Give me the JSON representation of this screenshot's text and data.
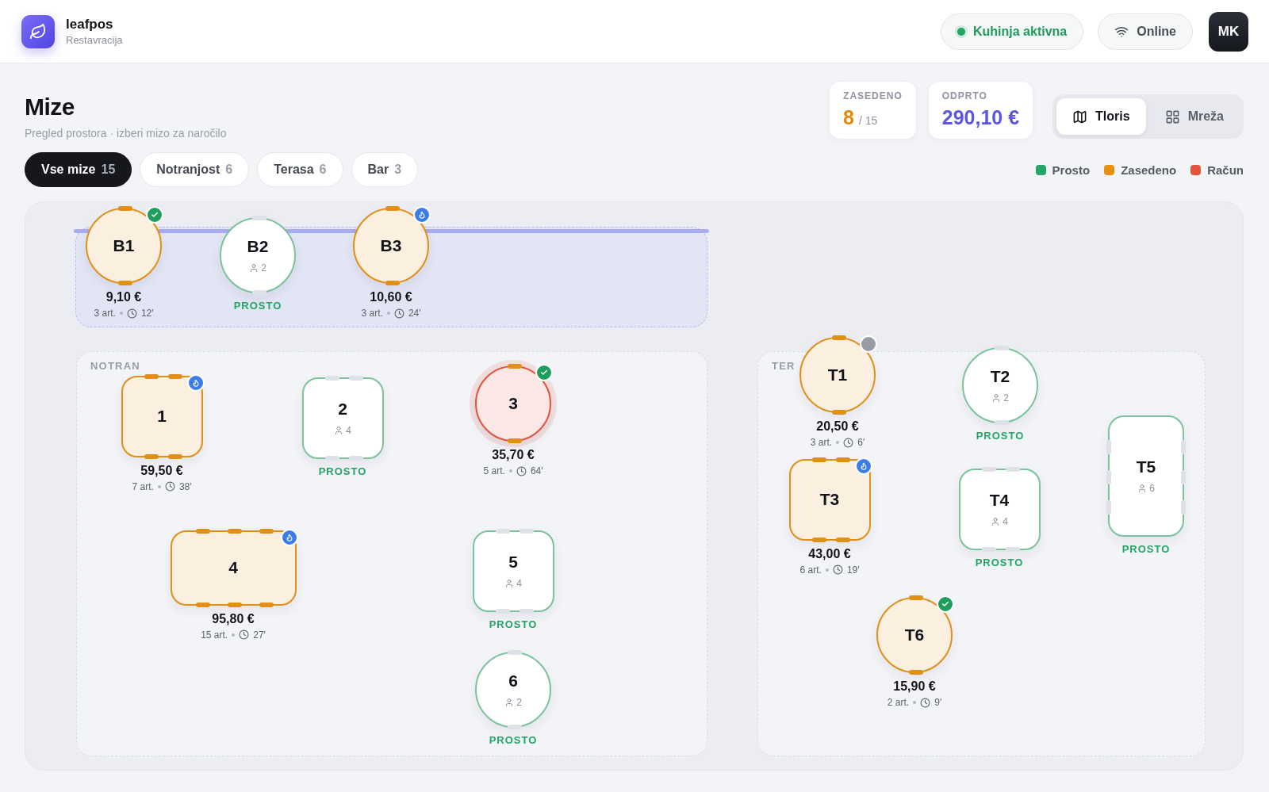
{
  "app": {
    "name": "leafpos",
    "subtitle": "Restavracija"
  },
  "header": {
    "kitchen": {
      "label": "Kuhinja aktivna",
      "on": true
    },
    "connection": {
      "label": "Online"
    },
    "user": {
      "initials": "MK"
    }
  },
  "page": {
    "title": "Mize",
    "subtitle": "Pregled prostora · izberi mizo za naročilo"
  },
  "stats": [
    {
      "label": "ZASEDENO",
      "value": "8",
      "suffix": "/ 15",
      "kind": "count"
    },
    {
      "label": "ODPRTO",
      "value": "290,10 €",
      "kind": "money"
    }
  ],
  "views": [
    {
      "label": "Tloris",
      "selected": true
    },
    {
      "label": "Mreža",
      "selected": false
    }
  ],
  "filters": [
    {
      "label": "Vse mize",
      "count": "15",
      "selected": true
    },
    {
      "label": "Notranjost",
      "count": "6",
      "selected": false
    },
    {
      "label": "Terasa",
      "count": "6",
      "selected": false
    },
    {
      "label": "Bar",
      "count": "3",
      "selected": false
    }
  ],
  "legend": [
    {
      "label": "Prosto",
      "color": "#22a565"
    },
    {
      "label": "Zasedeno",
      "color": "#e8900c"
    },
    {
      "label": "Račun",
      "color": "#e5533d"
    }
  ],
  "zones": [
    {
      "highlighted": true
    },
    {
      "label": "NOTRAN",
      "highlighted": false
    },
    {
      "label": "TER",
      "highlighted": false
    }
  ],
  "tables": [
    {
      "name": "B1",
      "kind": "round",
      "color": "#e08f17",
      "occupied": true,
      "bill": false,
      "badge": {
        "kind": "ready"
      },
      "price": "9,10 €",
      "items": "3 art.",
      "time": "12′"
    },
    {
      "name": "B2",
      "kind": "round",
      "color": "#7cc39c",
      "occupied": false,
      "bill": false,
      "seats": "2",
      "label": "PROSTO"
    },
    {
      "name": "B3",
      "kind": "round",
      "color": "#e08f17",
      "occupied": true,
      "bill": false,
      "badge": {
        "kind": "cooking"
      },
      "price": "10,60 €",
      "items": "3 art.",
      "time": "24′"
    },
    {
      "name": "1",
      "kind": "square",
      "color": "#e08f17",
      "occupied": true,
      "bill": false,
      "badge": {
        "kind": "cooking"
      },
      "price": "59,50 €",
      "items": "7 art.",
      "time": "38′"
    },
    {
      "name": "2",
      "kind": "square",
      "color": "#7cc39c",
      "occupied": false,
      "bill": false,
      "seats": "4",
      "label": "PROSTO"
    },
    {
      "name": "3",
      "kind": "round",
      "color": "#e0533f",
      "occupied": true,
      "bill": true,
      "badge": {
        "kind": "ready"
      },
      "price": "35,70 €",
      "items": "5 art.",
      "time": "64′"
    },
    {
      "name": "4",
      "kind": "wide",
      "color": "#e08f17",
      "occupied": true,
      "bill": false,
      "badge": {
        "kind": "cooking"
      },
      "price": "95,80 €",
      "items": "15 art.",
      "time": "27′"
    },
    {
      "name": "5",
      "kind": "square",
      "color": "#7cc39c",
      "occupied": false,
      "bill": false,
      "seats": "4",
      "label": "PROSTO"
    },
    {
      "name": "6",
      "kind": "round",
      "color": "#7cc39c",
      "occupied": false,
      "bill": false,
      "seats": "2",
      "label": "PROSTO"
    },
    {
      "name": "T1",
      "kind": "round",
      "color": "#e08f17",
      "occupied": true,
      "bill": false,
      "badge": {
        "kind": "waiting"
      },
      "price": "20,50 €",
      "items": "3 art.",
      "time": "6′"
    },
    {
      "name": "T2",
      "kind": "round",
      "color": "#7cc39c",
      "occupied": false,
      "bill": false,
      "seats": "2",
      "label": "PROSTO"
    },
    {
      "name": "T3",
      "kind": "square",
      "color": "#e08f17",
      "occupied": true,
      "bill": false,
      "badge": {
        "kind": "cooking"
      },
      "price": "43,00 €",
      "items": "6 art.",
      "time": "19′"
    },
    {
      "name": "T4",
      "kind": "square",
      "color": "#7cc39c",
      "occupied": false,
      "bill": false,
      "seats": "4",
      "label": "PROSTO"
    },
    {
      "name": "T5",
      "kind": "tall",
      "color": "#7cc39c",
      "occupied": false,
      "bill": false,
      "seats": "6",
      "label": "PROSTO"
    },
    {
      "name": "T6",
      "kind": "round",
      "color": "#e08f17",
      "occupied": true,
      "bill": false,
      "badge": {
        "kind": "ready"
      },
      "price": "15,90 €",
      "items": "2 art.",
      "time": "9′"
    }
  ]
}
